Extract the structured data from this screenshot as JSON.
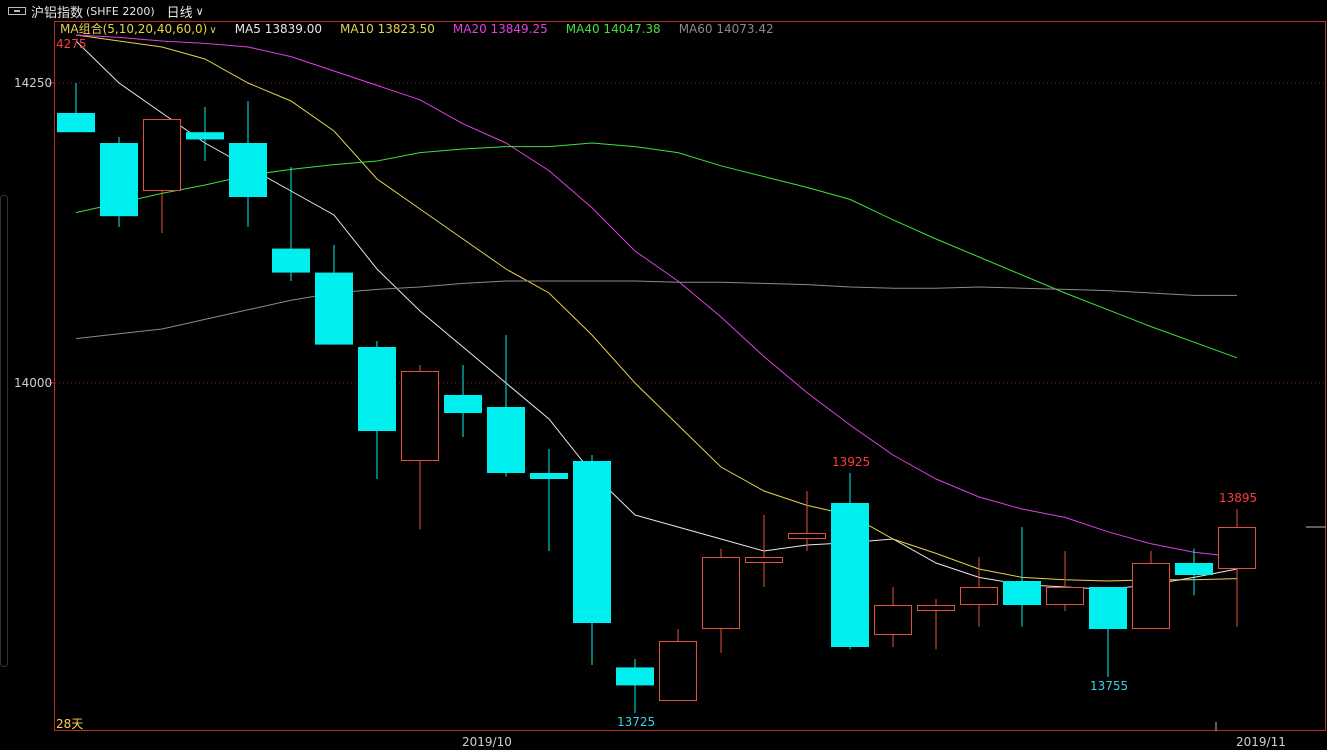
{
  "header": {
    "symbol": "沪铝指数",
    "exchange_code": "(SHFE 2200)",
    "period": "日线"
  },
  "legend": {
    "group_label": "MA组合(5,10,20,40,60,0)",
    "items": [
      {
        "text": "MA5 13839.00",
        "color": "#e8e8e8"
      },
      {
        "text": "MA10 13823.50",
        "color": "#e6d14a"
      },
      {
        "text": "MA20 13849.25",
        "color": "#e040e0"
      },
      {
        "text": "MA40 14047.38",
        "color": "#3ee03e"
      },
      {
        "text": "MA60 14073.42",
        "color": "#8a8a8a"
      }
    ]
  },
  "colors": {
    "up": "#e0533f",
    "down": "#00f0f0",
    "grid": "#8b1a1a",
    "frame": "#b5301f"
  },
  "chart_data": {
    "type": "candlestick",
    "y_ticks": [
      14000,
      14250
    ],
    "ylim": [
      13720,
      14300
    ],
    "x_ticks": [
      {
        "label": "2019/10",
        "index": 10
      },
      {
        "label": "2019/11",
        "index": 27
      }
    ],
    "days_label": "28天",
    "top_cut_label": "4275",
    "candles": [
      {
        "o": 14225,
        "h": 14250,
        "l": 14209,
        "c": 14209
      },
      {
        "o": 14200,
        "h": 14205,
        "l": 14130,
        "c": 14139
      },
      {
        "o": 14160,
        "h": 14220,
        "l": 14125,
        "c": 14220
      },
      {
        "o": 14209,
        "h": 14230,
        "l": 14185,
        "c": 14203
      },
      {
        "o": 14200,
        "h": 14235,
        "l": 14130,
        "c": 14155
      },
      {
        "o": 14112,
        "h": 14180,
        "l": 14085,
        "c": 14092
      },
      {
        "o": 14092,
        "h": 14115,
        "l": 14050,
        "c": 14032
      },
      {
        "o": 14030,
        "h": 14035,
        "l": 13920,
        "c": 13960
      },
      {
        "o": 13935,
        "h": 14015,
        "l": 13878,
        "c": 14010
      },
      {
        "o": 13990,
        "h": 14015,
        "l": 13955,
        "c": 13975
      },
      {
        "o": 13980,
        "h": 14040,
        "l": 13922,
        "c": 13925
      },
      {
        "o": 13925,
        "h": 13945,
        "l": 13860,
        "c": 13920
      },
      {
        "o": 13935,
        "h": 13940,
        "l": 13765,
        "c": 13800
      },
      {
        "o": 13763,
        "h": 13770,
        "l": 13725,
        "c": 13748
      },
      {
        "o": 13735,
        "h": 13795,
        "l": 13735,
        "c": 13785
      },
      {
        "o": 13795,
        "h": 13862,
        "l": 13775,
        "c": 13855
      },
      {
        "o": 13850,
        "h": 13890,
        "l": 13830,
        "c": 13855
      },
      {
        "o": 13870,
        "h": 13910,
        "l": 13860,
        "c": 13875
      },
      {
        "o": 13900,
        "h": 13925,
        "l": 13778,
        "c": 13780
      },
      {
        "o": 13790,
        "h": 13830,
        "l": 13780,
        "c": 13815
      },
      {
        "o": 13810,
        "h": 13820,
        "l": 13778,
        "c": 13815
      },
      {
        "o": 13815,
        "h": 13855,
        "l": 13797,
        "c": 13830
      },
      {
        "o": 13835,
        "h": 13880,
        "l": 13797,
        "c": 13815
      },
      {
        "o": 13815,
        "h": 13860,
        "l": 13810,
        "c": 13830
      },
      {
        "o": 13830,
        "h": 13830,
        "l": 13755,
        "c": 13795
      },
      {
        "o": 13795,
        "h": 13860,
        "l": 13795,
        "c": 13850
      },
      {
        "o": 13850,
        "h": 13862,
        "l": 13823,
        "c": 13840
      },
      {
        "o": 13845,
        "h": 13895,
        "l": 13797,
        "c": 13880
      }
    ],
    "ma": [
      {
        "name": "MA5",
        "color": "#e8e8e8",
        "values": [
          14285,
          14250,
          14225,
          14200,
          14180,
          14160,
          14140,
          14095,
          14060,
          14030,
          14000,
          13970,
          13925,
          13890,
          13880,
          13870,
          13860,
          13865,
          13867,
          13870,
          13850,
          13838,
          13832,
          13830,
          13828,
          13832,
          13838,
          13845
        ]
      },
      {
        "name": "MA10",
        "color": "#e6d14a",
        "values": [
          14290,
          14285,
          14280,
          14270,
          14250,
          14235,
          14210,
          14170,
          14145,
          14120,
          14095,
          14075,
          14040,
          14000,
          13965,
          13930,
          13910,
          13898,
          13890,
          13870,
          13858,
          13845,
          13838,
          13836,
          13835,
          13836,
          13836,
          13837
        ]
      },
      {
        "name": "MA20",
        "color": "#e040e0",
        "values": [
          14290,
          14288,
          14285,
          14283,
          14280,
          14272,
          14260,
          14248,
          14236,
          14216,
          14200,
          14177,
          14146,
          14110,
          14085,
          14055,
          14022,
          13992,
          13965,
          13940,
          13920,
          13905,
          13895,
          13888,
          13876,
          13866,
          13859,
          13855
        ]
      },
      {
        "name": "MA40",
        "color": "#3ee03e",
        "values": [
          14142,
          14150,
          14158,
          14165,
          14173,
          14178,
          14182,
          14185,
          14192,
          14195,
          14197,
          14197,
          14200,
          14197,
          14192,
          14181,
          14172,
          14163,
          14153,
          14136,
          14120,
          14105,
          14090,
          14075,
          14061,
          14047,
          14034,
          14021
        ]
      },
      {
        "name": "MA60",
        "color": "#8a8a8a",
        "values": [
          14037,
          14041,
          14045,
          14053,
          14061,
          14069,
          14075,
          14078,
          14080,
          14083,
          14085,
          14085,
          14085,
          14085,
          14084,
          14084,
          14083,
          14082,
          14080,
          14079,
          14079,
          14080,
          14079,
          14078,
          14077,
          14075,
          14073,
          14073
        ]
      }
    ],
    "annotations": [
      {
        "text": "13925",
        "index": 18,
        "value": 13925,
        "color": "#ff3b3b",
        "pos": "above"
      },
      {
        "text": "13895",
        "index": 27,
        "value": 13895,
        "color": "#ff3b3b",
        "pos": "above"
      },
      {
        "text": "13725",
        "index": 13,
        "value": 13725,
        "color": "#3ad0e0",
        "pos": "below"
      },
      {
        "text": "13755",
        "index": 24,
        "value": 13755,
        "color": "#3ad0e0",
        "pos": "below"
      }
    ]
  }
}
